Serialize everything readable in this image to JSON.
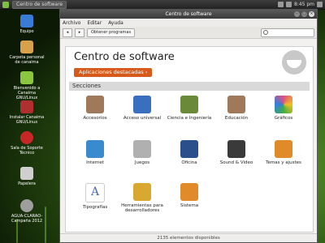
{
  "panel": {
    "task_label": "Centro de software",
    "clock": "8:45 pm"
  },
  "desktop_icons": [
    {
      "label": "Equipo",
      "color": "#3a7bd5"
    },
    {
      "label": "Carpeta personal de canaima",
      "color": "#d8a24a"
    },
    {
      "label": "Bienvenido a Canaima GNU/Linux",
      "color": "#8cc63f"
    },
    {
      "label": "Instalar Canaima GNU/Linux",
      "color": "#b03030"
    },
    {
      "label": "Sala de Soporte Técnico",
      "color": "#c62828"
    },
    {
      "label": "Papelera",
      "color": "#cfcfcf"
    },
    {
      "label": "AGUA-CLARAO-Campaña 2012",
      "color": "#9e9e9e"
    }
  ],
  "window": {
    "title": "Centro de software",
    "menu": [
      "Archivo",
      "Editar",
      "Ayuda"
    ],
    "toolbar": {
      "back": "◂",
      "forward": "▸",
      "get_programs": "Obtener programas",
      "search_placeholder": ""
    },
    "hero_title": "Centro de software",
    "featured_button": "Aplicaciones destacadas  ›",
    "sections_label": "Secciones",
    "status": "2135 elementos disponibles"
  },
  "categories": [
    {
      "label": "Accesorios",
      "color": "#a0785a"
    },
    {
      "label": "Acceso universal",
      "color": "#3a6fc0"
    },
    {
      "label": "Ciencia e Ingeniería",
      "color": "#6a8a3a"
    },
    {
      "label": "Educación",
      "color": "#a0785a"
    },
    {
      "label": "Gráficos",
      "color": "#e05080"
    },
    {
      "label": "Internet",
      "color": "#3a8ad0"
    },
    {
      "label": "Juegos",
      "color": "#b0b0b0"
    },
    {
      "label": "Oficina",
      "color": "#2a4f8a"
    },
    {
      "label": "Sound & Video",
      "color": "#3a3a3a"
    },
    {
      "label": "Temas y ajustes",
      "color": "#e08a2a"
    },
    {
      "label": "Tipografías",
      "color": "#4a6ab0"
    },
    {
      "label": "Herramientas para desarrolladores",
      "color": "#d8a830"
    },
    {
      "label": "Sistema",
      "color": "#e08a2a"
    }
  ]
}
